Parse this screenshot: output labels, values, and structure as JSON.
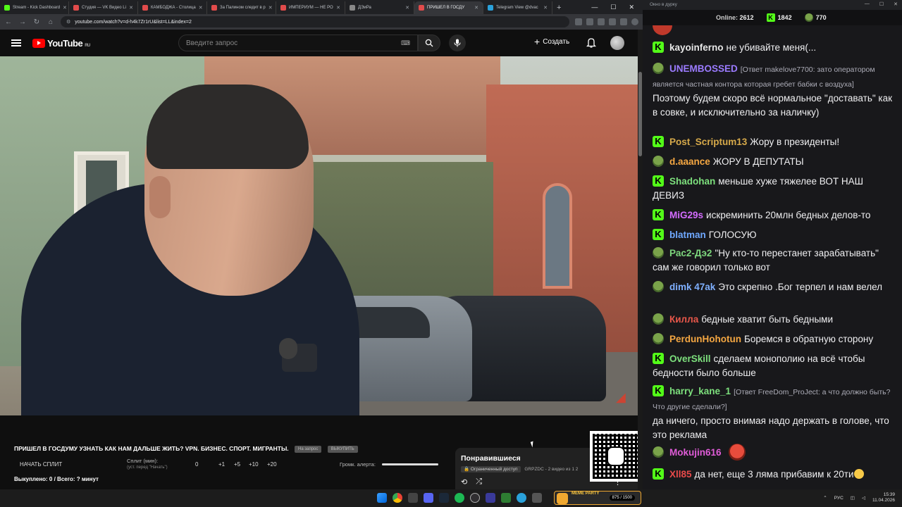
{
  "browser": {
    "tabs": [
      {
        "title": "Stream - Kick Dashboard",
        "color": "#53fc18",
        "active": false
      },
      {
        "title": "Студия — VK Видео Li",
        "color": "#e14b4b",
        "active": false
      },
      {
        "title": "КАМБОДЖА - Столица",
        "color": "#e14b4b",
        "active": false
      },
      {
        "title": "За Палином следит в р",
        "color": "#e14b4b",
        "active": false
      },
      {
        "title": "ИМПЕРИУМ — НЕ РО",
        "color": "#e14b4b",
        "active": false
      },
      {
        "title": "ДЭиРа",
        "color": "#888888",
        "active": false
      },
      {
        "title": "ПРИШЕЛ В ГОСДУ",
        "color": "#e14b4b",
        "active": true
      },
      {
        "title": "Telegram View @dvac",
        "color": "#2aa1da",
        "active": false
      }
    ],
    "url": "youtube.com/watch?v=d-h4k7Zr1rU&list=LL&index=2"
  },
  "youtube": {
    "logo_text": "YouTube",
    "region": "RU",
    "search_placeholder": "Введите запрос",
    "create_label": "Создать"
  },
  "video": {
    "title": "ПРИШЕЛ В ГОСДУМУ УЗНАТЬ КАК НАМ ДАЛЬШЕ ЖИТЬ? VPN. БИЗНЕС. СПОРТ. МИГРАНТЫ.",
    "chip_request": "На запрос",
    "chip_bought": "ВЫКУПИТЬ"
  },
  "split": {
    "start_label": "НАЧАТЬ СПЛИТ",
    "minutes_label": "Сплит (мин):",
    "minutes_hint": "(уст. перед \"Начать\")",
    "values": [
      "0",
      "+1",
      "+5",
      "+10",
      "+20"
    ],
    "alert_label": "Громк. алерта:",
    "alert_level": 1.0,
    "bought_status": "Выкуплено: 0 / Всего: ? минут"
  },
  "playlist": {
    "title": "Понравившиеся",
    "access": "Ограниченный доступ",
    "meta": "GRPZDC - 2 видео из 1 2"
  },
  "chat_header": {
    "window_title": "Окно в дурку",
    "online_label": "Online:",
    "online_count": "2612",
    "kick_count": "1842",
    "pepe_count": "770"
  },
  "chat": [
    {
      "badge": "kick",
      "user": "kayoinferno",
      "color": "#e8e8e8",
      "text": "не убивайте меня(..."
    },
    {
      "badge": "pepe",
      "user": "UNEMBOSSED",
      "color": "#9b7bff",
      "reply": "[Ответ makelove7700: зато оператором является частная контора которая гребет бабки с воздуха]",
      "text": "Поэтому будем скоро всё нормальное \"доставать\" как в совке, и исключительно за наличку)"
    },
    {
      "badge": "kick",
      "user": "Post_Scriptum13",
      "color": "#d6a94a",
      "text": "Жору в президенты!"
    },
    {
      "badge": "pepe",
      "user": "d.aaance",
      "color": "#f5a742",
      "text": "ЖОРУ В ДЕПУТАТЫ"
    },
    {
      "badge": "kick",
      "user": "Shadohan",
      "color": "#7de07d",
      "text": "меньше хуже тяжелее ВОТ НАШ ДЕВИЗ"
    },
    {
      "badge": "kick",
      "user": "MiG29s",
      "color": "#d36cff",
      "text": "искреминить 20млн бедных делов-то"
    },
    {
      "badge": "kick",
      "user": "blatman",
      "color": "#6fa8ff",
      "text": "ГОЛОСУЮ"
    },
    {
      "badge": "pepe",
      "user": "Рас2-Дэ2",
      "color": "#7dd67d",
      "text": "\"Ну кто-то перестанет зарабатывать\" сам же говорил только вот"
    },
    {
      "badge": "pepe",
      "user": "dimk 47ak",
      "color": "#7fb0ff",
      "text": "Это скрепно .Бог терпел и нам велел"
    },
    {
      "badge": "pepe",
      "user": "Килла",
      "color": "#e8574a",
      "text": "бедные хватит быть бедными"
    },
    {
      "badge": "pepe",
      "user": "PerdunHohotun",
      "color": "#f5a742",
      "text": "Боремся в обратную сторону"
    },
    {
      "badge": "kick",
      "user": "OverSkill",
      "color": "#7de07d",
      "text": "сделаем монополию на всё чтобы бедности было больше"
    },
    {
      "badge": "kick",
      "user": "harry_kane_1",
      "color": "#7de07d",
      "reply": "[Ответ FreeDom_ProJect: а что должно быть? Что другие сделали?]",
      "text": "да ничего, просто внимая надо держать в голове, что это реклама"
    },
    {
      "badge": "pepe",
      "user": "Mokujin616",
      "color": "#e05cd8",
      "text": ""
    },
    {
      "badge": "kick",
      "user": "Xll85",
      "color": "#e84a4a",
      "text": "да нет, еще 3 ляма прибавим к 20ти"
    }
  ],
  "taskbar": {
    "lang": "РУС",
    "time": "15:39",
    "date": "11.04.2026",
    "meme_party_label": "MEME PARTY",
    "meme_count": "875 / 1500"
  }
}
